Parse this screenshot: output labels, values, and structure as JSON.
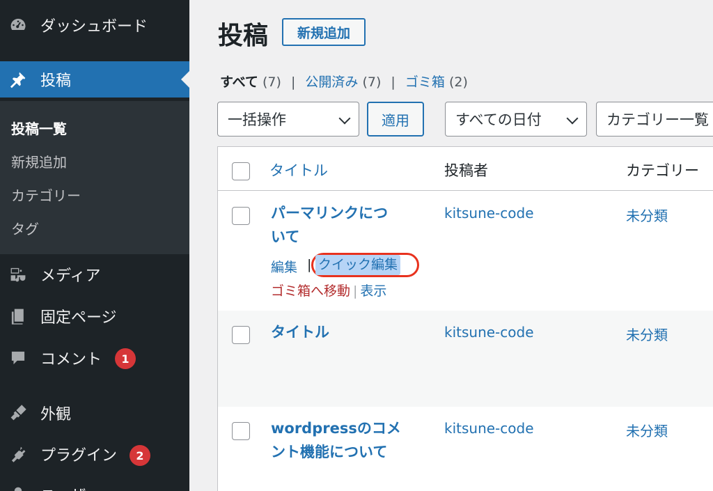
{
  "sidebar": {
    "menu": [
      {
        "label": "ダッシュボード",
        "icon": "dashboard-icon"
      },
      {
        "label": "投稿",
        "icon": "pin-icon"
      },
      {
        "label": "メディア",
        "icon": "media-icon"
      },
      {
        "label": "固定ページ",
        "icon": "pages-icon"
      },
      {
        "label": "コメント",
        "icon": "comment-icon",
        "badge": "1"
      },
      {
        "label": "外観",
        "icon": "brush-icon"
      },
      {
        "label": "プラグイン",
        "icon": "plugin-icon",
        "badge": "2"
      },
      {
        "label": "ユーザー",
        "icon": "user-icon"
      }
    ],
    "submenu": [
      "投稿一覧",
      "新規追加",
      "カテゴリー",
      "タグ"
    ]
  },
  "header": {
    "title": "投稿",
    "add_new": "新規追加"
  },
  "filters": {
    "all": "すべて",
    "all_count": "(7)",
    "published": "公開済み",
    "published_count": "(7)",
    "trash": "ゴミ箱",
    "trash_count": "(2)"
  },
  "toolbar": {
    "bulk_action": "一括操作",
    "apply": "適用",
    "dates": "すべての日付",
    "category": "カテゴリー一覧"
  },
  "table": {
    "columns": [
      "タイトル",
      "投稿者",
      "カテゴリー"
    ],
    "rows": [
      {
        "title_line1": "パーマリンクにつ",
        "title_line2": "いて",
        "author": "kitsune-code",
        "category": "未分類"
      },
      {
        "title_line1": "タイトル",
        "title_line2": "",
        "author": "kitsune-code",
        "category": "未分類"
      },
      {
        "title_line1": "wordpressのコメ",
        "title_line2": "ント機能について",
        "author": "kitsune-code",
        "category": "未分類"
      }
    ],
    "row_actions": {
      "edit": "編集",
      "quick_edit": "クイック編集",
      "trash": "ゴミ箱へ移動",
      "view": "表示"
    }
  },
  "colors": {
    "accent": "#2271b1",
    "sidebar": "#1d2327",
    "highlight_ring": "#e8321e",
    "badge": "#d63638"
  }
}
